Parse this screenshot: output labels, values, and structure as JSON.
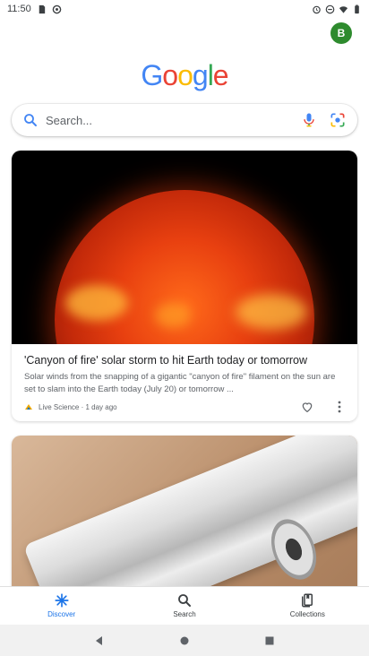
{
  "status_bar": {
    "time": "11:50",
    "left_icons": [
      "sim-card-icon",
      "circle-status-icon"
    ],
    "right_icons": [
      "alarm-icon",
      "do-not-disturb-icon",
      "wifi-icon",
      "battery-icon"
    ]
  },
  "account": {
    "avatar_letter": "B",
    "avatar_color": "#2e8b2e"
  },
  "logo": {
    "letters": [
      "G",
      "o",
      "o",
      "g",
      "l",
      "e"
    ],
    "colors": [
      "#4285f4",
      "#ea4335",
      "#fbbc05",
      "#4285f4",
      "#34a853",
      "#ea4335"
    ]
  },
  "search": {
    "placeholder": "Search...",
    "value": ""
  },
  "feed": {
    "cards": [
      {
        "title": "'Canyon of fire' solar storm to hit Earth today or tomorrow",
        "snippet": "Solar winds from the snapping of a gigantic \"canyon of fire\" filament on the sun are set to slam into the Earth today (July 20) or tomorrow ...",
        "source": "Live Science",
        "age": "1 day ago"
      }
    ]
  },
  "bottom_nav": {
    "items": [
      {
        "label": "Discover",
        "icon": "discover-asterisk-icon",
        "active": true
      },
      {
        "label": "Search",
        "icon": "search-icon",
        "active": false
      },
      {
        "label": "Collections",
        "icon": "collections-icon",
        "active": false
      }
    ]
  },
  "accent_color": "#1a73e8"
}
